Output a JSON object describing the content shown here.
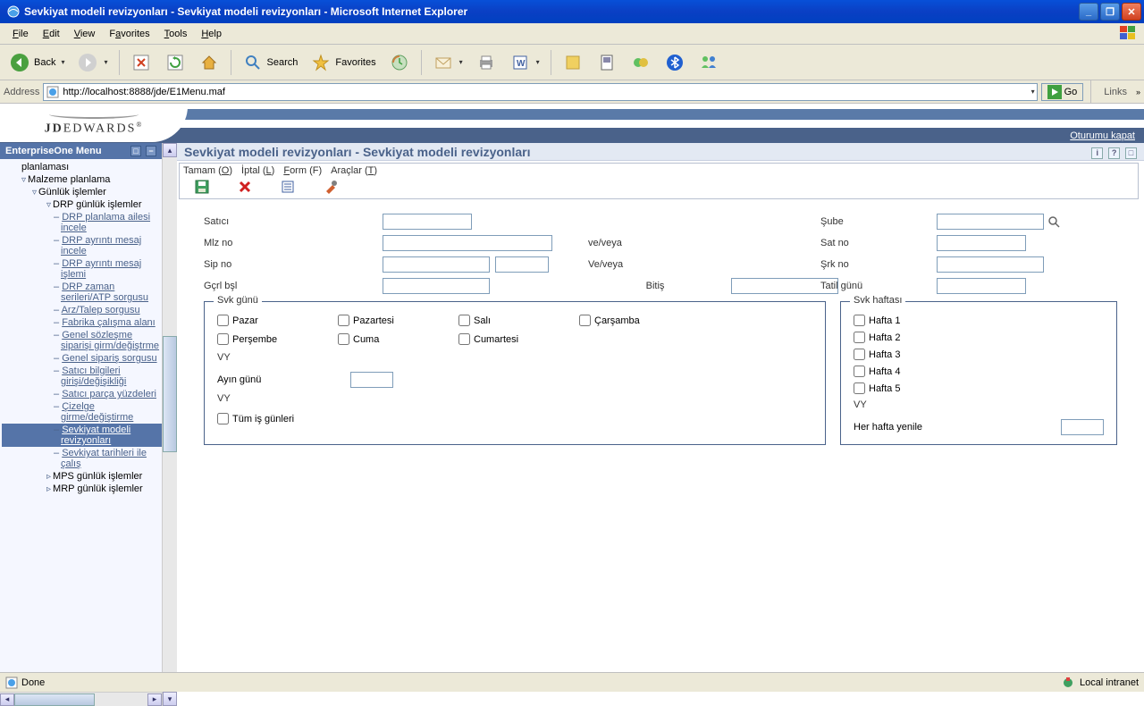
{
  "window": {
    "title": "Sevkiyat modeli revizyonları - Sevkiyat modeli revizyonları - Microsoft Internet Explorer"
  },
  "menubar": {
    "file": "File",
    "edit": "Edit",
    "view": "View",
    "favorites": "Favorites",
    "tools": "Tools",
    "help": "Help"
  },
  "toolbar": {
    "back": "Back",
    "search": "Search",
    "favorites": "Favorites"
  },
  "address": {
    "label": "Address",
    "url": "http://localhost:8888/jde/E1Menu.maf",
    "go": "Go",
    "links": "Links"
  },
  "app_header": {
    "logo": "JDEDWARDS",
    "logout": "Oturumu kapat"
  },
  "leftnav": {
    "title": "EnterpriseOne Menu",
    "items": [
      {
        "level": 1,
        "type": "text",
        "label": "planlaması"
      },
      {
        "level": 1,
        "type": "tri-open",
        "label": "Malzeme planlama"
      },
      {
        "level": 2,
        "type": "tri-open",
        "label": "Günlük işlemler"
      },
      {
        "level": 3,
        "type": "tri-open",
        "label": "DRP günlük işlemler"
      },
      {
        "level": 4,
        "type": "dash",
        "label": "DRP planlama ailesi incele"
      },
      {
        "level": 4,
        "type": "dash",
        "label": "DRP ayrıntı mesaj incele"
      },
      {
        "level": 4,
        "type": "dash",
        "label": "DRP ayrıntı mesaj işlemi"
      },
      {
        "level": 4,
        "type": "dash",
        "label": "DRP zaman serileri/ATP sorgusu"
      },
      {
        "level": 4,
        "type": "dash",
        "label": "Arz/Talep sorgusu"
      },
      {
        "level": 4,
        "type": "dash",
        "label": "Fabrika çalışma alanı"
      },
      {
        "level": 4,
        "type": "dash",
        "label": "Genel sözleşme siparişi girm/değiştrme"
      },
      {
        "level": 4,
        "type": "dash",
        "label": "Genel sipariş sorgusu"
      },
      {
        "level": 4,
        "type": "dash",
        "label": "Satıcı bilgileri girişi/değişikliği"
      },
      {
        "level": 4,
        "type": "dash",
        "label": "Satıcı parça yüzdeleri"
      },
      {
        "level": 4,
        "type": "dash",
        "label": "Çizelge girme/değiştirme"
      },
      {
        "level": 4,
        "type": "dash",
        "label": "Sevkiyat modeli revizyonları",
        "selected": true
      },
      {
        "level": 4,
        "type": "dash",
        "label": "Sevkiyat tarihleri ile çalış"
      },
      {
        "level": 3,
        "type": "tri",
        "label": "MPS günlük işlemler"
      },
      {
        "level": 3,
        "type": "tri",
        "label": "MRP günlük işlemler"
      }
    ]
  },
  "page": {
    "title": "Sevkiyat modeli revizyonları - Sevkiyat modeli revizyonları",
    "actions": {
      "tamam": "Tamam (O)",
      "iptal": "İptal (L)",
      "form": "Form (F)",
      "araclar": "Araçlar (T)"
    }
  },
  "form": {
    "labels": {
      "satici": "Satıcı",
      "mlzno": "Mlz no",
      "sipno": "Sip no",
      "gcrlbsl": "Gçrl bşl",
      "veveya": "ve/veya",
      "veveya2": "Ve/veya",
      "bitis": "Bitiş",
      "sube": "Şube",
      "satno": "Sat no",
      "srkno": "Şrk no",
      "tatilgunu": "Tatil günü"
    },
    "group1": {
      "legend": "Svk günü",
      "days": {
        "pazar": "Pazar",
        "pazartesi": "Pazartesi",
        "sali": "Salı",
        "carsamba": "Çarşamba",
        "persembe": "Perşembe",
        "cuma": "Cuma",
        "cumartesi": "Cumartesi"
      },
      "vy": "VY",
      "ayingunu": "Ayın günü",
      "tumis": "Tüm iş günleri"
    },
    "group2": {
      "legend": "Svk haftası",
      "weeks": {
        "h1": "Hafta 1",
        "h2": "Hafta 2",
        "h3": "Hafta 3",
        "h4": "Hafta 4",
        "h5": "Hafta 5"
      },
      "vy": "VY",
      "heryenile": "Her hafta yenile"
    }
  },
  "status": {
    "done": "Done",
    "zone": "Local intranet"
  }
}
